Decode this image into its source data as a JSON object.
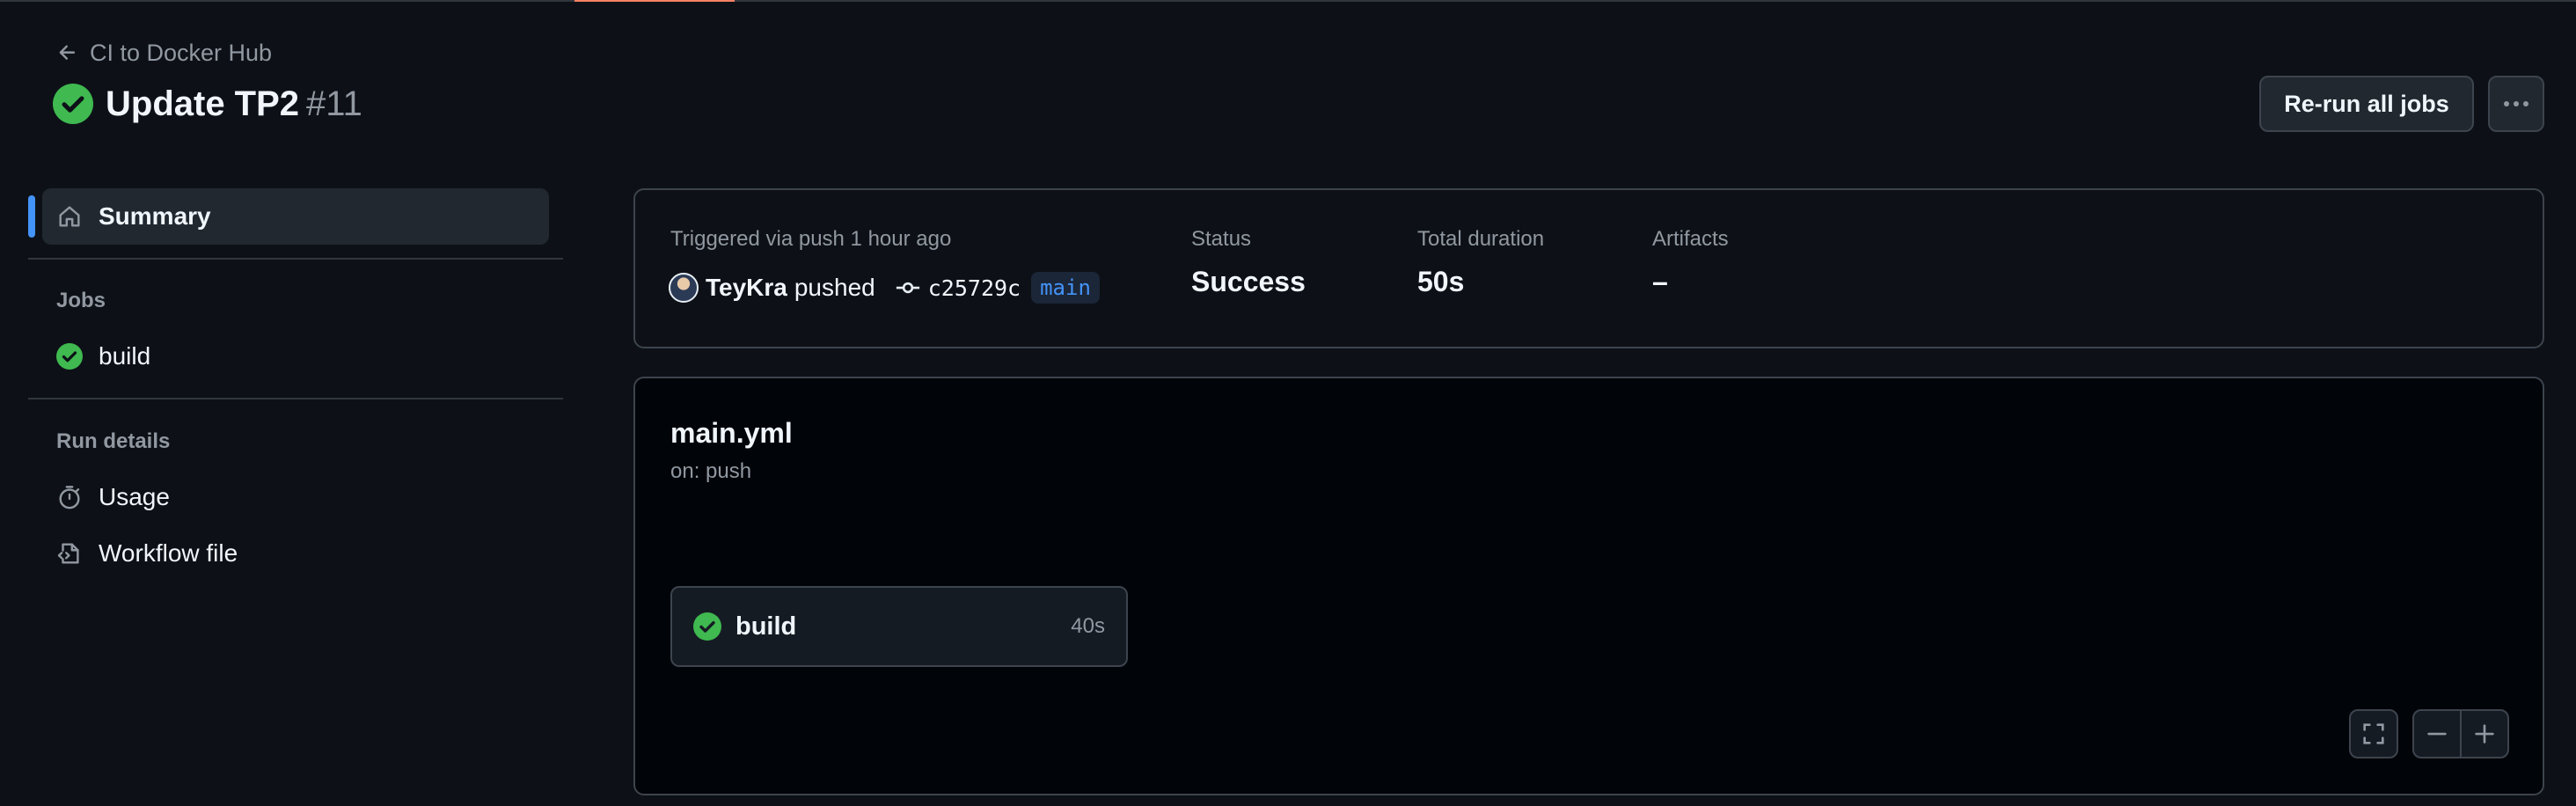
{
  "header": {
    "back_label": "CI to Docker Hub",
    "run_title": "Update TP2",
    "run_number": "#11",
    "rerun_label": "Re-run all jobs",
    "more_label": "···"
  },
  "sidebar": {
    "summary_label": "Summary",
    "jobs_heading": "Jobs",
    "jobs": [
      {
        "label": "build",
        "status": "success"
      }
    ],
    "run_details_heading": "Run details",
    "details": [
      {
        "label": "Usage",
        "icon": "stopwatch-icon"
      },
      {
        "label": "Workflow file",
        "icon": "file-code-icon"
      }
    ]
  },
  "summary": {
    "trigger_label": "Triggered via push 1 hour ago",
    "actor": "TeyKra",
    "action": "pushed",
    "commit_sha": "c25729c",
    "branch": "main",
    "status_label": "Status",
    "status_value": "Success",
    "duration_label": "Total duration",
    "duration_value": "50s",
    "artifacts_label": "Artifacts",
    "artifacts_value": "–"
  },
  "graph": {
    "workflow_file": "main.yml",
    "trigger": "on: push",
    "job_name": "build",
    "job_duration": "40s"
  },
  "colors": {
    "background": "#0d1117",
    "success": "#3fb950",
    "accent": "#4493f8",
    "tab_underline": "#f78166"
  }
}
